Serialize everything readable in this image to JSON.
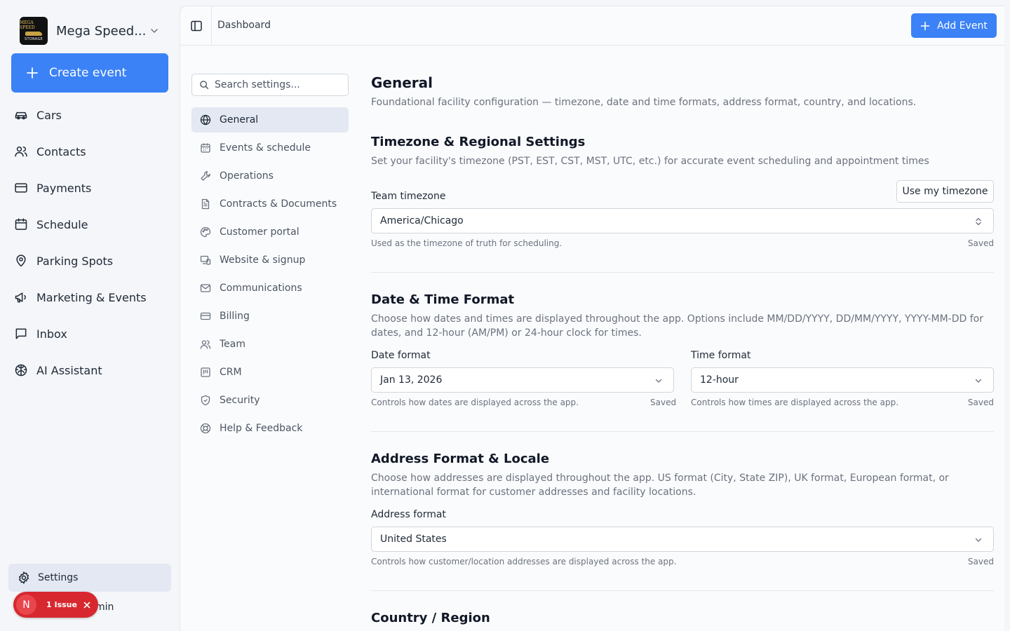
{
  "brand": {
    "name": "Mega Speed...",
    "logo_top": "MEGA SPEED",
    "logo_bottom": "STORAGE"
  },
  "sidebar": {
    "create_label": "Create event",
    "items": [
      {
        "label": "Cars",
        "icon": "car-icon"
      },
      {
        "label": "Contacts",
        "icon": "users-icon"
      },
      {
        "label": "Payments",
        "icon": "credit-card-icon"
      },
      {
        "label": "Schedule",
        "icon": "calendar-icon"
      },
      {
        "label": "Parking Spots",
        "icon": "map-pin-icon"
      },
      {
        "label": "Marketing & Events",
        "icon": "megaphone-icon"
      },
      {
        "label": "Inbox",
        "icon": "message-square-icon"
      },
      {
        "label": "AI Assistant",
        "icon": "brain-icon"
      }
    ],
    "settings_label": "Settings",
    "admin_label": "min",
    "issue": {
      "avatar": "N",
      "label": "1 Issue"
    }
  },
  "topbar": {
    "breadcrumb": "Dashboard",
    "add_event_label": "Add Event"
  },
  "settings_nav": {
    "search_placeholder": "Search settings...",
    "items": [
      {
        "label": "General",
        "icon": "globe-icon",
        "active": true
      },
      {
        "label": "Events & schedule",
        "icon": "calendar-icon"
      },
      {
        "label": "Operations",
        "icon": "wrench-icon"
      },
      {
        "label": "Contracts & Documents",
        "icon": "file-text-icon"
      },
      {
        "label": "Customer portal",
        "icon": "palette-icon"
      },
      {
        "label": "Website & signup",
        "icon": "devices-icon"
      },
      {
        "label": "Communications",
        "icon": "mail-icon"
      },
      {
        "label": "Billing",
        "icon": "credit-card-icon"
      },
      {
        "label": "Team",
        "icon": "users-icon"
      },
      {
        "label": "CRM",
        "icon": "columns-icon"
      },
      {
        "label": "Security",
        "icon": "shield-icon"
      },
      {
        "label": "Help & Feedback",
        "icon": "life-buoy-icon"
      }
    ]
  },
  "content": {
    "title": "General",
    "subtitle": "Foundational facility configuration — timezone, date and time formats, address format, country, and locations.",
    "timezone": {
      "title": "Timezone & Regional Settings",
      "description": "Set your facility's timezone (PST, EST, CST, MST, UTC, etc.) for accurate event scheduling and appointment times",
      "label": "Team timezone",
      "use_my_timezone": "Use my timezone",
      "value": "America/Chicago",
      "help": "Used as the timezone of truth for scheduling.",
      "status": "Saved"
    },
    "datetime": {
      "title": "Date & Time Format",
      "description": "Choose how dates and times are displayed throughout the app. Options include MM/DD/YYYY, DD/MM/YYYY, YYYY-MM-DD for dates, and 12-hour (AM/PM) or 24-hour clock for times.",
      "date_label": "Date format",
      "date_value": "Jan 13, 2026",
      "date_help": "Controls how dates are displayed across the app.",
      "date_status": "Saved",
      "time_label": "Time format",
      "time_value": "12-hour",
      "time_help": "Controls how times are displayed across the app.",
      "time_status": "Saved"
    },
    "address": {
      "title": "Address Format & Locale",
      "description": "Choose how addresses are displayed throughout the app. US format (City, State ZIP), UK format, European format, or international format for customer addresses and facility locations.",
      "label": "Address format",
      "value": "United States",
      "help": "Controls how customer/location addresses are displayed across the app.",
      "status": "Saved"
    },
    "country": {
      "title": "Country / Region"
    }
  },
  "colors": {
    "accent": "#3b82f6",
    "active_bg": "#e3e8f3",
    "issue_red": "#d7282f"
  }
}
